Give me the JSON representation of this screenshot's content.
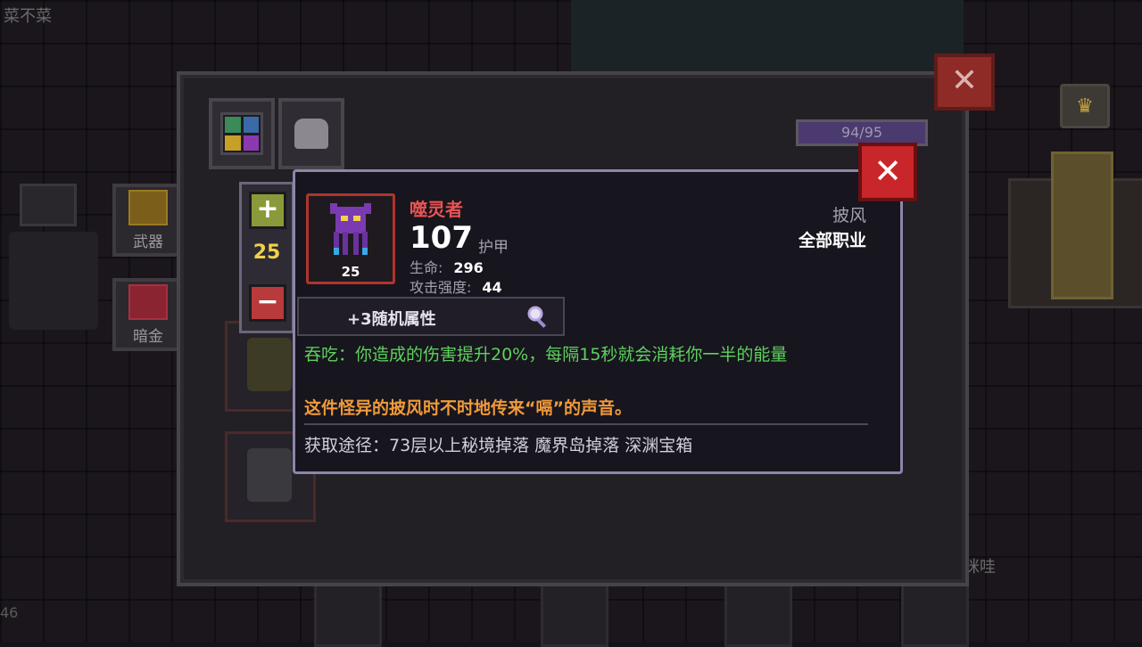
{
  "background": {
    "top_left_name": "菜不菜",
    "bottom_left_number": "46",
    "bottom_right_name": "咪哇"
  },
  "inventory": {
    "capacity": "94/95",
    "side_tabs": [
      {
        "label": "武器",
        "icon": "sword-icon"
      },
      {
        "label": "暗金",
        "icon": "chest-icon"
      }
    ],
    "close_symbol": "✕"
  },
  "level_control": {
    "plus_symbol": "+",
    "minus_symbol": "−",
    "value": "25"
  },
  "item": {
    "name": "噬灵者",
    "level_badge": "25",
    "armor_value": "107",
    "armor_label": "护甲",
    "stats": [
      {
        "label": "生命:",
        "value": "296"
      },
      {
        "label": "攻击强度:",
        "value": "44"
      }
    ],
    "type": "披风",
    "class_requirement": "全部职业",
    "random_attribute": "+3随机属性",
    "effect_description": "吞吃：你造成的伤害提升20%，每隔15秒就会消耗你一半的能量",
    "flavor_text": "这件怪异的披风时不时地传来“嗝”的声音。",
    "source": "获取途径：73层以上秘境掉落 魔界岛掉落 深渊宝箱",
    "colors": {
      "name": "#e85454",
      "effect": "#5dd15d",
      "flavor": "#f09a3a",
      "frame": "#b0342f"
    }
  },
  "card_close_symbol": "✕"
}
